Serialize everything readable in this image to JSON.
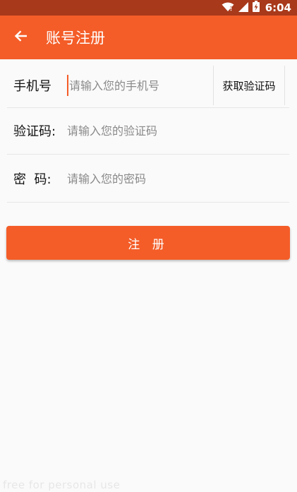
{
  "status_bar": {
    "time": "6:04",
    "icons": [
      "wifi-icon",
      "signal-icon",
      "battery-icon"
    ]
  },
  "app_bar": {
    "title": "账号注册",
    "back_icon": "arrow-left-icon"
  },
  "form": {
    "phone": {
      "label": "手机号",
      "placeholder": "请输入您的手机号",
      "value": ""
    },
    "verify_button_label": "获取验证码",
    "code": {
      "label": "验证码:",
      "placeholder": "请输入您的验证码",
      "value": ""
    },
    "password": {
      "label": "密  码:",
      "placeholder": "请输入您的密码",
      "value": ""
    }
  },
  "register_button_label": "注 册",
  "watermark": "free for personal use",
  "colors": {
    "primary": "#f45d28",
    "status_bar": "#a8391a",
    "background": "#fafafa"
  }
}
